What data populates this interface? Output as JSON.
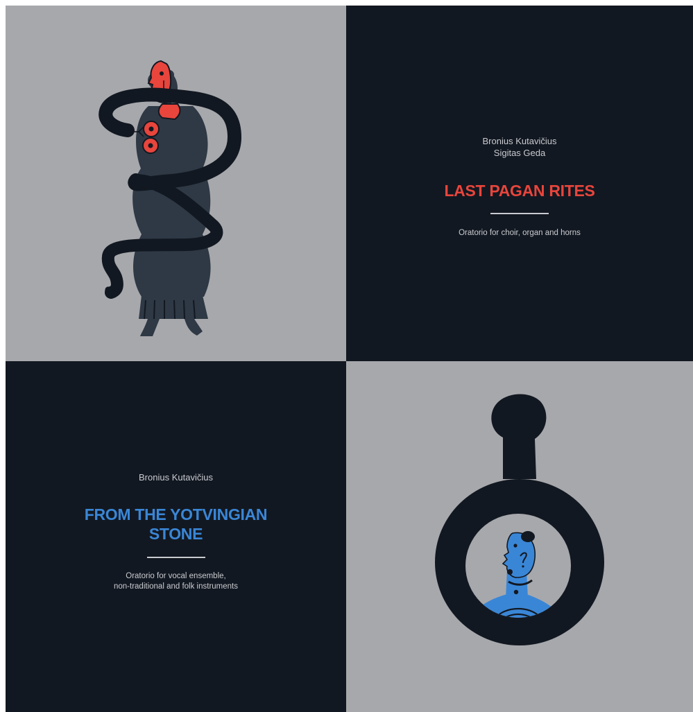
{
  "colors": {
    "light_panel": "#a7a8ac",
    "dark_panel": "#121821",
    "accent_red": "#e8453c",
    "accent_blue": "#3a86d6",
    "figure": "#2e3945",
    "serpent": "#121821",
    "text_light": "#c9cbd0"
  },
  "cards": [
    {
      "authors": [
        "Bronius Kutavičius",
        "Sigitas Geda"
      ],
      "title": "LAST PAGAN RITES",
      "subtitle": "Oratorio for choir, organ and horns",
      "title_color": "#e8453c",
      "illustration": "woman-with-serpent"
    },
    {
      "authors": [
        "Bronius Kutavičius"
      ],
      "title_lines": [
        "FROM THE YOTVINGIAN",
        "STONE"
      ],
      "subtitle_lines": [
        "Oratorio for vocal ensemble,",
        "non-traditional and folk instruments"
      ],
      "title_color": "#3a86d6",
      "illustration": "figure-in-stone-ring"
    }
  ]
}
